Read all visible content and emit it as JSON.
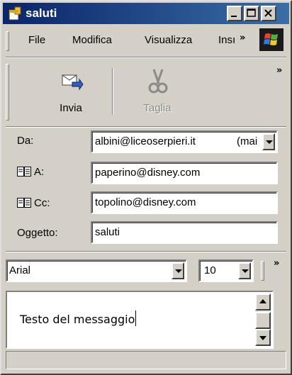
{
  "window": {
    "title": "saluti"
  },
  "menubar": {
    "items": [
      "File",
      "Modifica",
      "Visualizza",
      "Insı"
    ],
    "overflow": "»"
  },
  "toolbar": {
    "send_label": "Invia",
    "cut_label": "Taglia",
    "overflow": "»"
  },
  "fields": {
    "from_label": "Da:",
    "from_value": "albini@liceoserpieri.it",
    "from_account": "(mai",
    "to_label": "A:",
    "to_value": "paperino@disney.com",
    "cc_label": "Cc:",
    "cc_value": "topolino@disney.com",
    "subject_label": "Oggetto:",
    "subject_value": "saluti"
  },
  "format": {
    "font": "Arial",
    "size": "10",
    "overflow": "»"
  },
  "message": {
    "body": "Testo del messaggio"
  },
  "colors": {
    "titlebar_start": "#0a246a",
    "titlebar_end": "#3a6ea5",
    "face": "#d4d0c8"
  },
  "icons": [
    "compose-icon",
    "minimize-icon",
    "maximize-icon",
    "close-icon",
    "windows-logo-icon",
    "send-icon",
    "scissors-icon",
    "address-book-icon",
    "dropdown-arrow-icon",
    "scroll-up-icon",
    "scroll-down-icon"
  ]
}
